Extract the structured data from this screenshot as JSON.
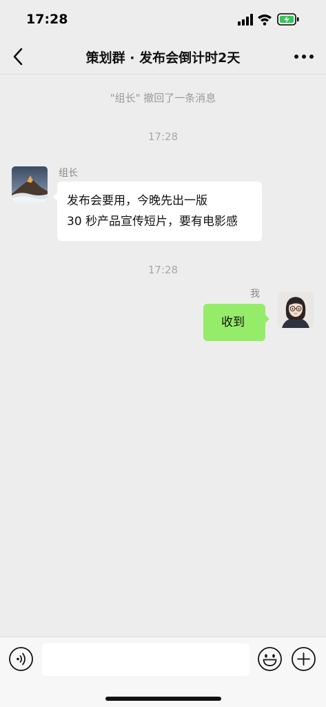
{
  "status_bar": {
    "time": "17:28"
  },
  "header": {
    "title": "策划群 · 发布会倒计时2天"
  },
  "system_notice": "\"组长\" 撤回了一条消息",
  "messages": [
    {
      "timestamp": "17:28",
      "sender": "组长",
      "direction": "incoming",
      "avatar_icon": "mountain-avatar",
      "lines": [
        "发布会要用，今晚先出一版",
        "30 秒产品宣传短片，要有电影感"
      ]
    },
    {
      "timestamp": "17:28",
      "sender": "我",
      "direction": "outgoing",
      "avatar_icon": "girl-avatar",
      "lines": [
        "收到"
      ]
    }
  ],
  "input": {
    "value": "",
    "placeholder": ""
  },
  "colors": {
    "background": "#ededed",
    "outgoing_bubble": "#95ec69",
    "incoming_bubble": "#ffffff",
    "battery": "#34c759"
  }
}
